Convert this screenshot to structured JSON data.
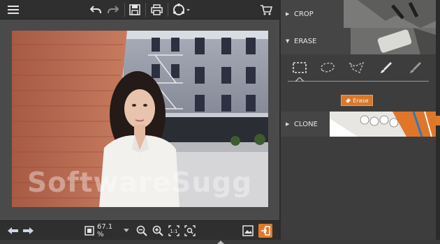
{
  "toolbar": {
    "menu_icon": "hamburger-menu-icon",
    "undo_icon": "undo-icon",
    "redo_icon": "redo-icon",
    "save_icon": "save-icon",
    "print_icon": "print-icon",
    "share_icon": "share-icon",
    "cart_icon": "cart-icon"
  },
  "canvas": {
    "watermark": "SoftwareSugg"
  },
  "bottombar": {
    "zoom": "67.1 %",
    "actual_size_label": "1:1"
  },
  "panel": {
    "sections": {
      "crop": "CROP",
      "erase": "ERASE",
      "clone": "CLONE"
    },
    "erase_button_label": "Erase",
    "tools": [
      "rectangle-select-icon",
      "lasso-icon",
      "polygon-lasso-icon",
      "brush-icon",
      "eraser-brush-icon"
    ]
  },
  "colors": {
    "accent": "#e07a2a",
    "panel_bg": "#3d3d3d",
    "toolbar_bg": "#2f2f2f",
    "canvas_bg": "#4a4a4a"
  }
}
